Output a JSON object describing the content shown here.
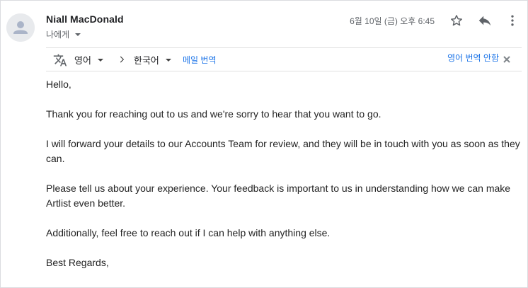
{
  "message": {
    "sender": "Niall MacDonald",
    "recipient": "나에게",
    "date": "6월 10일 (금) 오후 6:45"
  },
  "translate_bar": {
    "source_lang": "영어",
    "target_lang": "한국어",
    "translate_label": "메일 번역",
    "dont_translate_label": "영어 번역 안함"
  },
  "body": {
    "paragraphs": [
      "Hello,",
      "Thank you for reaching out to us and we're sorry to hear that you want to go.",
      "I will forward your details to our Accounts Team for review, and they will be in touch with you as soon as they can.",
      "Please tell us about your experience. Your feedback is important to us in understanding how we can make Artlist even better.",
      "Additionally, feel free to reach out if I can help with anything else.",
      "Best Regards,"
    ]
  },
  "icons": {
    "avatar": "person-icon",
    "star": "star-icon",
    "reply": "reply-icon",
    "more": "more-vert-icon",
    "translate": "translate-icon",
    "arrow": "chevron-right-icon",
    "close": "close-icon"
  },
  "colors": {
    "link": "#1a73e8",
    "avatar_bg": "#e8eaed",
    "avatar_fg": "#aab4c8"
  }
}
